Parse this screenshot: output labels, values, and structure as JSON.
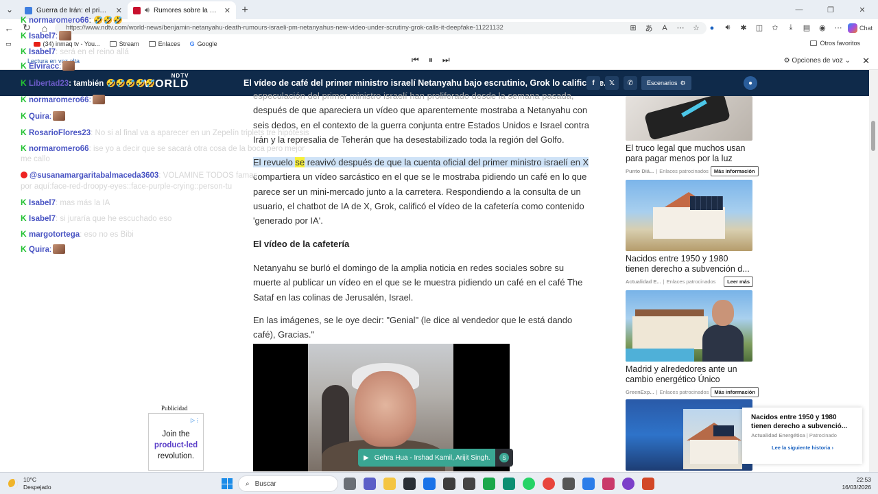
{
  "browser": {
    "tabs": [
      {
        "title": "Guerra de Irán: el primer ciberata",
        "favicon_color": "#3f7fe0"
      },
      {
        "title": "Rumores sobre la muerte de N",
        "favicon_color": "#c8102e"
      }
    ],
    "url": "https://www.ndtv.com/world-news/benjamin-netanyahu-death-rumours-israeli-pm-netanyahus-new-video-under-scrutiny-grok-calls-it-deepfake-11221132",
    "copilot_label": "Chat",
    "bookmarks": [
      {
        "label": "(34) inmaq tv - You...",
        "icon": "youtube-icon"
      },
      {
        "label": "Stream",
        "icon": "folder-icon"
      },
      {
        "label": "Enlaces",
        "icon": "folder-icon"
      },
      {
        "label": "Google",
        "icon": "google-icon"
      }
    ],
    "other_favorites": "Otros favoritos",
    "read_aloud": {
      "label": "Lectura en voz alta",
      "voice_options": "Opciones de voz"
    }
  },
  "site": {
    "logo_top": "NDTV",
    "logo_bottom": "WORLD",
    "headline": "El vídeo de café del primer ministro israelí Netanyahu bajo escrutinio, Grok lo califica de...",
    "escenarios_label": "Escenarios"
  },
  "article": {
    "p1_partial": "especulación del primer ministro israelí han proliferado desde la semana pasada,",
    "p1": "después de que apareciera un vídeo que aparentemente mostraba a Netanyahu con seis dedos, en el contexto de la guerra conjunta entre Estados Unidos e Israel contra Irán y la represalia de Teherán que ha desestabilizado toda la región del Golfo.",
    "p2_a": "El revuelo ",
    "p2_hl": "se",
    "p2_b": " reavivó después de que la cuenta oficial del primer ministro israelí en X",
    "p2_c": " compartiera un vídeo sarcástico en el que se le mostraba pidiendo un café en lo que parece ser un mini-mercado junto a la carretera. Respondiendo a la consulta de un usuario, el chatbot de IA de X, Grok, calificó el vídeo de la cafetería como contenido 'generado por IA'.",
    "h3": "El vídeo de la cafetería",
    "p3": "Netanyahu se burló el domingo de la amplia noticia en redes sociales sobre su muerte al publicar un vídeo en el que se le muestra pidiendo un café en el café The Sataf en las colinas de Jerusalén, Israel.",
    "p4": "En las imágenes, se le oye decir: \"Genial\" (le dice al vendedor que le está dando café), Gracias.\""
  },
  "player": {
    "song": "Gehra Hua - Irshad Kamil, Arijit Singh."
  },
  "left_ad": {
    "label": "Publicidad",
    "line1": "Join the",
    "line2": "product-led",
    "line3": "revolution."
  },
  "ads": [
    {
      "title": "El truco legal que muchos usan para pagar menos por la luz",
      "source": "Punto Diá...",
      "sponsored": "Enlaces patrocinados",
      "button": "Más información"
    },
    {
      "title": "Nacidos entre 1950 y 1980 tienen derecho a subvención d...",
      "source": "Actualidad E...",
      "sponsored": "Enlaces patrocinados",
      "button": "Leer más"
    },
    {
      "title": "Madrid y alrededores ante un cambio energético Único",
      "source": "GreenExp...",
      "sponsored": "Enlaces patrocinados",
      "button": "Más información"
    }
  ],
  "popup": {
    "title": "Nacidos entre 1950 y 1980 tienen derecho a subvenció...",
    "source": "Actualidad Energética",
    "sponsored": "Patrocinado",
    "link": "Lee la siguiente historia ›"
  },
  "chat": [
    {
      "user": "normaromero66",
      "text": ": 🤣🤣🤣",
      "color": "#4a55c3",
      "emote": false,
      "platform": "kick"
    },
    {
      "user": "Isabel7",
      "text": ":",
      "color": "#4a55c3",
      "emote": true,
      "platform": "kick"
    },
    {
      "user": "Isabel7",
      "text": ": será en el reino allá",
      "color": "#4a55c3",
      "emote": false,
      "platform": "kick"
    },
    {
      "user": "Elviracc",
      "text": ":",
      "color": "#4a55c3",
      "emote": true,
      "platform": "kick"
    },
    {
      "user": "Libertad23",
      "text": ": también 🤣🤣🤣🤣🤣",
      "color": "#6b5bc7",
      "emote": false,
      "platform": "kick"
    },
    {
      "user": "normaromero66",
      "text": ":",
      "color": "#4a55c3",
      "emote": true,
      "platform": "kick"
    },
    {
      "user": "Quira",
      "text": ":",
      "color": "#4a55c3",
      "emote": true,
      "platform": "kick"
    },
    {
      "user": "RosarioFlores23",
      "text": ": No si al final va a aparecer en un Zepelín triplets tre hipótesis",
      "color": "#4a55c3",
      "emote": false,
      "platform": "kick"
    },
    {
      "user": "normaromero66",
      "text": ": ise yo a decir que se sacará otra cosa de la boca pero mejor",
      "color": "#4a55c3",
      "emote": false,
      "platform": "kick"
    },
    {
      "user": "me callo",
      "text": "",
      "color": "#d6d6d6",
      "emote": false,
      "platform": "none"
    },
    {
      "user": "@susanamargaritabalmaceda3603",
      "text": ": VOLAMINE TODOS famas",
      "color": "#4a55c3",
      "emote": false,
      "platform": "youtube"
    },
    {
      "user": "por aquí:face-red-droopy-eyes::face-purple-crying::person-tu",
      "text": "",
      "color": "#d6d6d6",
      "emote": false,
      "platform": "none"
    },
    {
      "user": "Isabel7",
      "text": ": mas más la IA",
      "color": "#4a55c3",
      "emote": false,
      "platform": "kick"
    },
    {
      "user": "Isabel7",
      "text": ": si juraría que he escuchado eso",
      "color": "#4a55c3",
      "emote": false,
      "platform": "kick"
    },
    {
      "user": "margotortega",
      "text": ": eso no es Bibi",
      "color": "#4a55c3",
      "emote": false,
      "platform": "kick"
    },
    {
      "user": "Quira",
      "text": ":",
      "color": "#4a55c3",
      "emote": true,
      "platform": "kick"
    }
  ],
  "taskbar": {
    "temp": "10°C",
    "condition": "Despejado",
    "search_placeholder": "Buscar",
    "time": "22:53",
    "date": "16/03/2026"
  }
}
